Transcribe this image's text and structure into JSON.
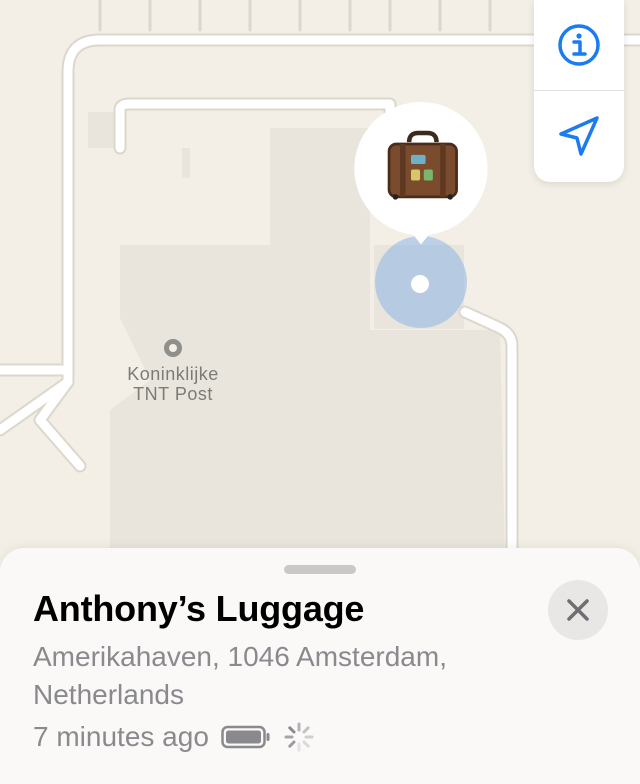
{
  "map": {
    "poi": {
      "name_line1": "Koninklijke",
      "name_line2": "TNT Post",
      "icon": "poi-ring-icon"
    },
    "controls": {
      "info_icon": "info-circle-icon",
      "location_icon": "location-arrow-icon",
      "accent_color": "#1a7cf0"
    },
    "pin": {
      "icon": "suitcase-icon"
    }
  },
  "item": {
    "name": "Anthony’s Luggage",
    "address_line1": "Amerikahaven, 1046 Amsterdam,",
    "address_line2": "Netherlands",
    "last_seen": "7 minutes ago",
    "battery_icon": "battery-icon",
    "loading_icon": "spinner-icon",
    "close_icon": "close-icon"
  }
}
